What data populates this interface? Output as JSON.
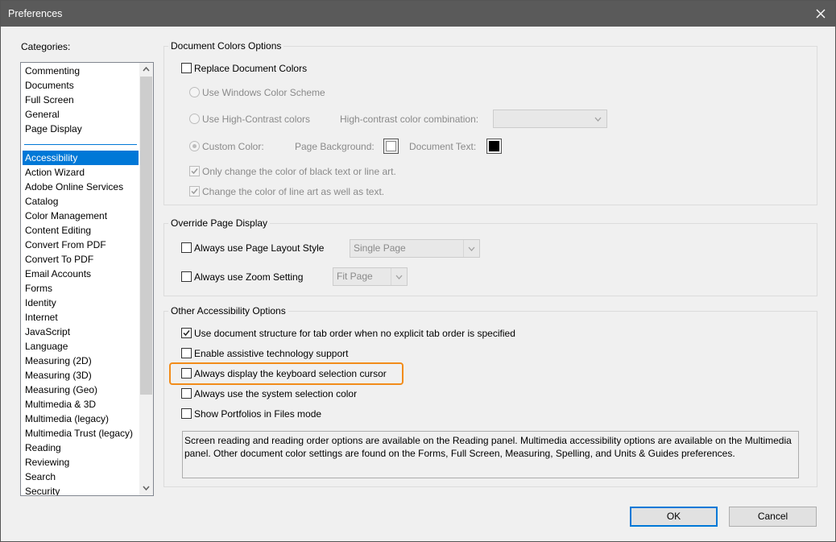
{
  "window": {
    "title": "Preferences"
  },
  "categories": {
    "label": "Categories:",
    "items": [
      "Commenting",
      "Documents",
      "Full Screen",
      "General",
      "Page Display",
      "Accessibility",
      "Action Wizard",
      "Adobe Online Services",
      "Catalog",
      "Color Management",
      "Content Editing",
      "Convert From PDF",
      "Convert To PDF",
      "Email Accounts",
      "Forms",
      "Identity",
      "Internet",
      "JavaScript",
      "Language",
      "Measuring (2D)",
      "Measuring (3D)",
      "Measuring (Geo)",
      "Multimedia & 3D",
      "Multimedia (legacy)",
      "Multimedia Trust (legacy)",
      "Reading",
      "Reviewing",
      "Search",
      "Security"
    ],
    "selected": "Accessibility"
  },
  "doc_colors": {
    "title": "Document Colors Options",
    "replace": "Replace Document Colors",
    "windows_scheme": "Use Windows Color Scheme",
    "high_contrast": "Use High-Contrast colors",
    "hc_combo_label": "High-contrast color combination:",
    "custom": "Custom Color:",
    "page_bg": "Page Background:",
    "doc_text": "Document Text:",
    "only_black": "Only change the color of black text or line art.",
    "line_art": "Change the color of line art as well as text.",
    "page_bg_color": "#ffffff",
    "doc_text_color": "#000000"
  },
  "override": {
    "title": "Override Page Display",
    "page_layout": "Always use Page Layout Style",
    "page_layout_value": "Single Page",
    "zoom": "Always use Zoom Setting",
    "zoom_value": "Fit Page"
  },
  "other": {
    "title": "Other Accessibility Options",
    "doc_structure": "Use document structure for tab order when no explicit tab order is specified",
    "assistive": "Enable assistive technology support",
    "keyboard_cursor": "Always display the keyboard selection cursor",
    "system_color": "Always use the system selection color",
    "portfolios": "Show Portfolios in Files mode",
    "info_text": "Screen reading and reading order options are available on the Reading panel. Multimedia accessibility options are available on the Multimedia panel. Other document color settings are found on the Forms, Full Screen, Measuring, Spelling, and Units & Guides preferences."
  },
  "buttons": {
    "ok": "OK",
    "cancel": "Cancel"
  },
  "colors": {
    "accent": "#0078d7",
    "highlight": "#f28c1a",
    "titlebar": "#5a5a5a"
  }
}
